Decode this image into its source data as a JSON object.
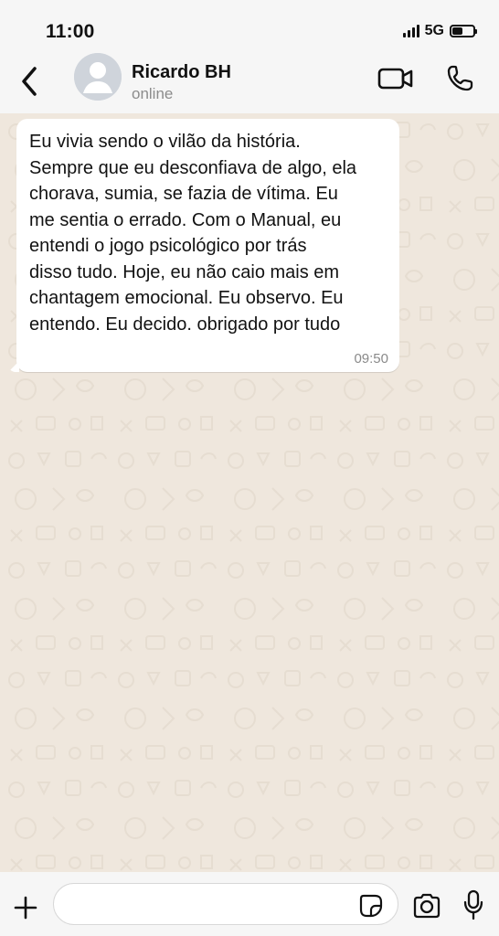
{
  "status_bar": {
    "time": "11:00",
    "network": "5G"
  },
  "header": {
    "contact_name": "Ricardo BH",
    "contact_status": "online"
  },
  "messages": [
    {
      "text": "Eu vivia sendo o vilão da história.\nSempre que eu desconfiava de algo, ela\nchorava, sumia, se fazia de vítima. Eu\nme sentia o errado. Com o Manual, eu\nentendi o jogo psicológico por trás\ndisso tudo. Hoje, eu não caio mais em\nchantagem emocional. Eu observo. Eu\nentendo. Eu decido. obrigado por tudo",
      "time": "09:50"
    }
  ],
  "composer": {
    "value": "",
    "placeholder": ""
  },
  "icons": {
    "back": "chevron-left-icon",
    "avatar": "person-icon",
    "video": "video-camera-icon",
    "call": "phone-icon",
    "plus": "plus-icon",
    "sticker": "sticker-icon",
    "camera": "camera-icon",
    "mic": "microphone-icon"
  },
  "colors": {
    "chat_background": "#efe7dd",
    "bubble_incoming": "#ffffff",
    "status_muted": "#8c8c8c"
  }
}
